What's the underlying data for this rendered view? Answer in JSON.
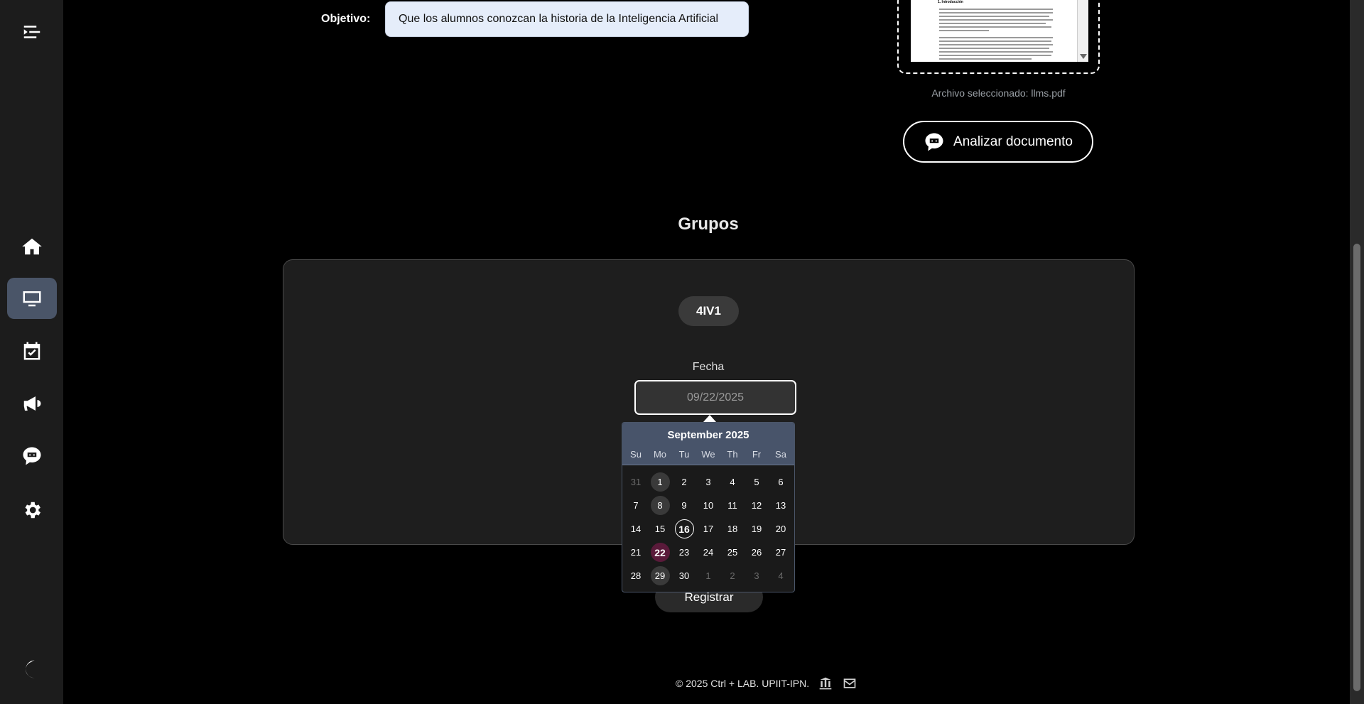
{
  "sidebar": {
    "items": [
      {
        "icon": "menu-collapse-icon"
      },
      {
        "icon": "home-icon"
      },
      {
        "icon": "monitor-icon",
        "active": true
      },
      {
        "icon": "calendar-check-icon"
      },
      {
        "icon": "megaphone-icon"
      },
      {
        "icon": "chat-bot-icon"
      },
      {
        "icon": "gear-icon"
      },
      {
        "icon": "moon-icon"
      }
    ]
  },
  "form": {
    "objetivo_label": "Objetivo:",
    "objetivo_value": "Que los alumnos conozcan la historia de la Inteligencia Artificial"
  },
  "document": {
    "preview_heading": "1. Introducción",
    "archivo_text": "Archivo seleccionado: llms.pdf",
    "analizar_label": "Analizar documento"
  },
  "grupos": {
    "title": "Grupos",
    "group_name": "4IV1",
    "fecha_label": "Fecha",
    "fecha_value": "09/22/2025",
    "registrar_label": "Registrar"
  },
  "datepicker": {
    "month_label": "September 2025",
    "dows": [
      "Su",
      "Mo",
      "Tu",
      "We",
      "Th",
      "Fr",
      "Sa"
    ],
    "weeks": [
      [
        "31",
        "1",
        "2",
        "3",
        "4",
        "5",
        "6"
      ],
      [
        "7",
        "8",
        "9",
        "10",
        "11",
        "12",
        "13"
      ],
      [
        "14",
        "15",
        "16",
        "17",
        "18",
        "19",
        "20"
      ],
      [
        "21",
        "22",
        "23",
        "24",
        "25",
        "26",
        "27"
      ],
      [
        "28",
        "29",
        "30",
        "1",
        "2",
        "3",
        "4"
      ]
    ],
    "outside_days": [
      "0-0",
      "4-3",
      "4-4",
      "4-5",
      "4-6"
    ],
    "highlighted_days": [
      "0-1",
      "1-1",
      "4-1"
    ],
    "today": "2-2",
    "selected": "3-1",
    "selected_color": "#5a1a3a"
  },
  "footer": {
    "copyright": "© 2025 Ctrl + LAB. UPIIT-IPN.",
    "icons": [
      "institution-icon",
      "envelope-icon"
    ]
  }
}
